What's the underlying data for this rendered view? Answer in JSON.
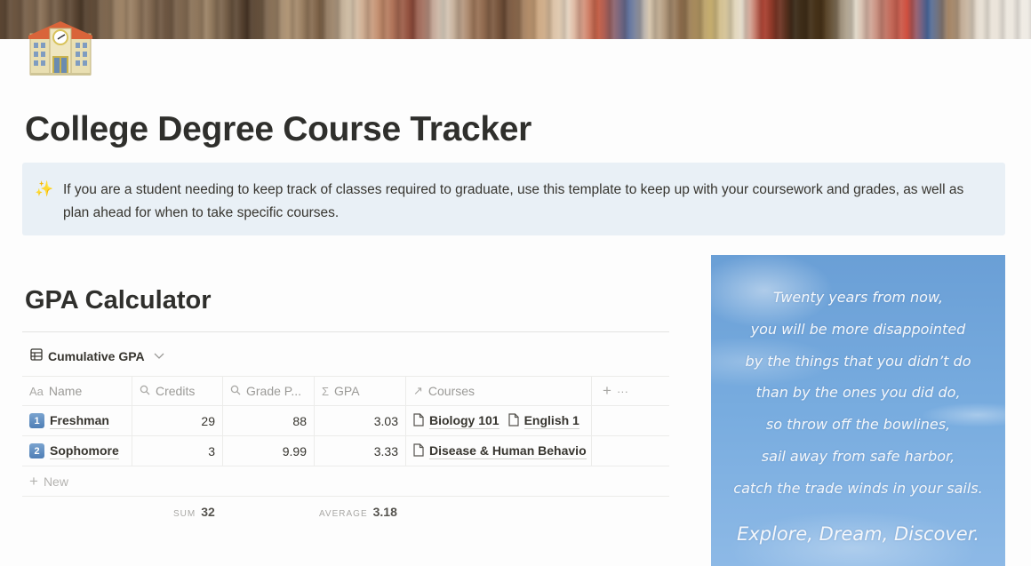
{
  "cover": {
    "description": "library bookshelf cover image"
  },
  "page": {
    "icon": "school-building-icon",
    "title": "College Degree Course Tracker"
  },
  "callout": {
    "icon": "sparkles-icon",
    "text": "If you are a student needing to keep track of classes required to graduate, use this template to keep up with your coursework and grades, as well as plan ahead for when to take specific courses."
  },
  "gpa_section": {
    "heading": "GPA Calculator",
    "view": {
      "icon": "table-icon",
      "label": "Cumulative GPA",
      "chevron": "chevron-down-icon"
    },
    "columns": [
      {
        "icon": "Aa",
        "icon_name": "title-property-icon",
        "label": "Name"
      },
      {
        "icon": "⌕",
        "icon_name": "lookup-icon",
        "label": "Credits"
      },
      {
        "icon": "⌕",
        "icon_name": "lookup-icon",
        "label": "Grade P..."
      },
      {
        "icon": "Σ",
        "icon_name": "formula-icon",
        "label": "GPA"
      },
      {
        "icon": "↗",
        "icon_name": "relation-icon",
        "label": "Courses"
      }
    ],
    "add_column": "+",
    "more_options": "···",
    "rows": [
      {
        "badge": "1",
        "name": "Freshman",
        "credits": "29",
        "grade_points": "88",
        "gpa": "3.03",
        "courses": [
          "Biology 101",
          "English 1"
        ]
      },
      {
        "badge": "2",
        "name": "Sophomore",
        "credits": "3",
        "grade_points": "9.99",
        "gpa": "3.33",
        "courses": [
          "Disease & Human Behavio"
        ]
      }
    ],
    "new_row": {
      "icon": "+",
      "label": "New"
    },
    "footer": {
      "credits_calc_label": "SUM",
      "credits_calc_value": "32",
      "gpa_calc_label": "AVERAGE",
      "gpa_calc_value": "3.18"
    }
  },
  "quote_image": {
    "lines": [
      "Twenty years from now,",
      "you will be more disappointed",
      "by the things that you didn’t do",
      "than by the ones you did do,",
      "so throw off the bowlines,",
      "sail away from safe harbor,",
      "catch the trade winds in your sails."
    ],
    "tagline": "Explore, Dream, Discover."
  }
}
